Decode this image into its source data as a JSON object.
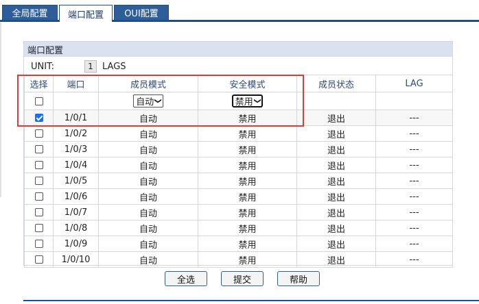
{
  "tabs": [
    {
      "label": "全局配置",
      "active": false
    },
    {
      "label": "端口配置",
      "active": true
    },
    {
      "label": "OUI配置",
      "active": false
    }
  ],
  "panel": {
    "title": "端口配置",
    "unit_label": "UNIT:",
    "unit_value": "1",
    "lags_label": "LAGS"
  },
  "table": {
    "headers": [
      "选择",
      "端口",
      "成员模式",
      "安全模式",
      "成员状态",
      "LAG"
    ],
    "filter": {
      "member_mode": "自动",
      "security_mode": "禁用"
    },
    "rows": [
      {
        "checked": true,
        "port": "1/0/1",
        "member_mode": "自动",
        "security_mode": "禁用",
        "status": "退出",
        "lag": "---"
      },
      {
        "checked": false,
        "port": "1/0/2",
        "member_mode": "自动",
        "security_mode": "禁用",
        "status": "退出",
        "lag": "---"
      },
      {
        "checked": false,
        "port": "1/0/3",
        "member_mode": "自动",
        "security_mode": "禁用",
        "status": "退出",
        "lag": "---"
      },
      {
        "checked": false,
        "port": "1/0/4",
        "member_mode": "自动",
        "security_mode": "禁用",
        "status": "退出",
        "lag": "---"
      },
      {
        "checked": false,
        "port": "1/0/5",
        "member_mode": "自动",
        "security_mode": "禁用",
        "status": "退出",
        "lag": "---"
      },
      {
        "checked": false,
        "port": "1/0/6",
        "member_mode": "自动",
        "security_mode": "禁用",
        "status": "退出",
        "lag": "---"
      },
      {
        "checked": false,
        "port": "1/0/7",
        "member_mode": "自动",
        "security_mode": "禁用",
        "status": "退出",
        "lag": "---"
      },
      {
        "checked": false,
        "port": "1/0/8",
        "member_mode": "自动",
        "security_mode": "禁用",
        "status": "退出",
        "lag": "---"
      },
      {
        "checked": false,
        "port": "1/0/9",
        "member_mode": "自动",
        "security_mode": "禁用",
        "status": "退出",
        "lag": "---"
      },
      {
        "checked": false,
        "port": "1/0/10",
        "member_mode": "自动",
        "security_mode": "禁用",
        "status": "退出",
        "lag": "---"
      }
    ]
  },
  "buttons": {
    "select_all": "全选",
    "submit": "提交",
    "help": "帮助"
  },
  "colors": {
    "tab_active_bg": "#ffffff",
    "tab_inactive_bg": "#2e5e9a",
    "header_bar": "#d9e2ee",
    "highlight": "#e53935",
    "checkbox_checked": "#1a73e8"
  }
}
